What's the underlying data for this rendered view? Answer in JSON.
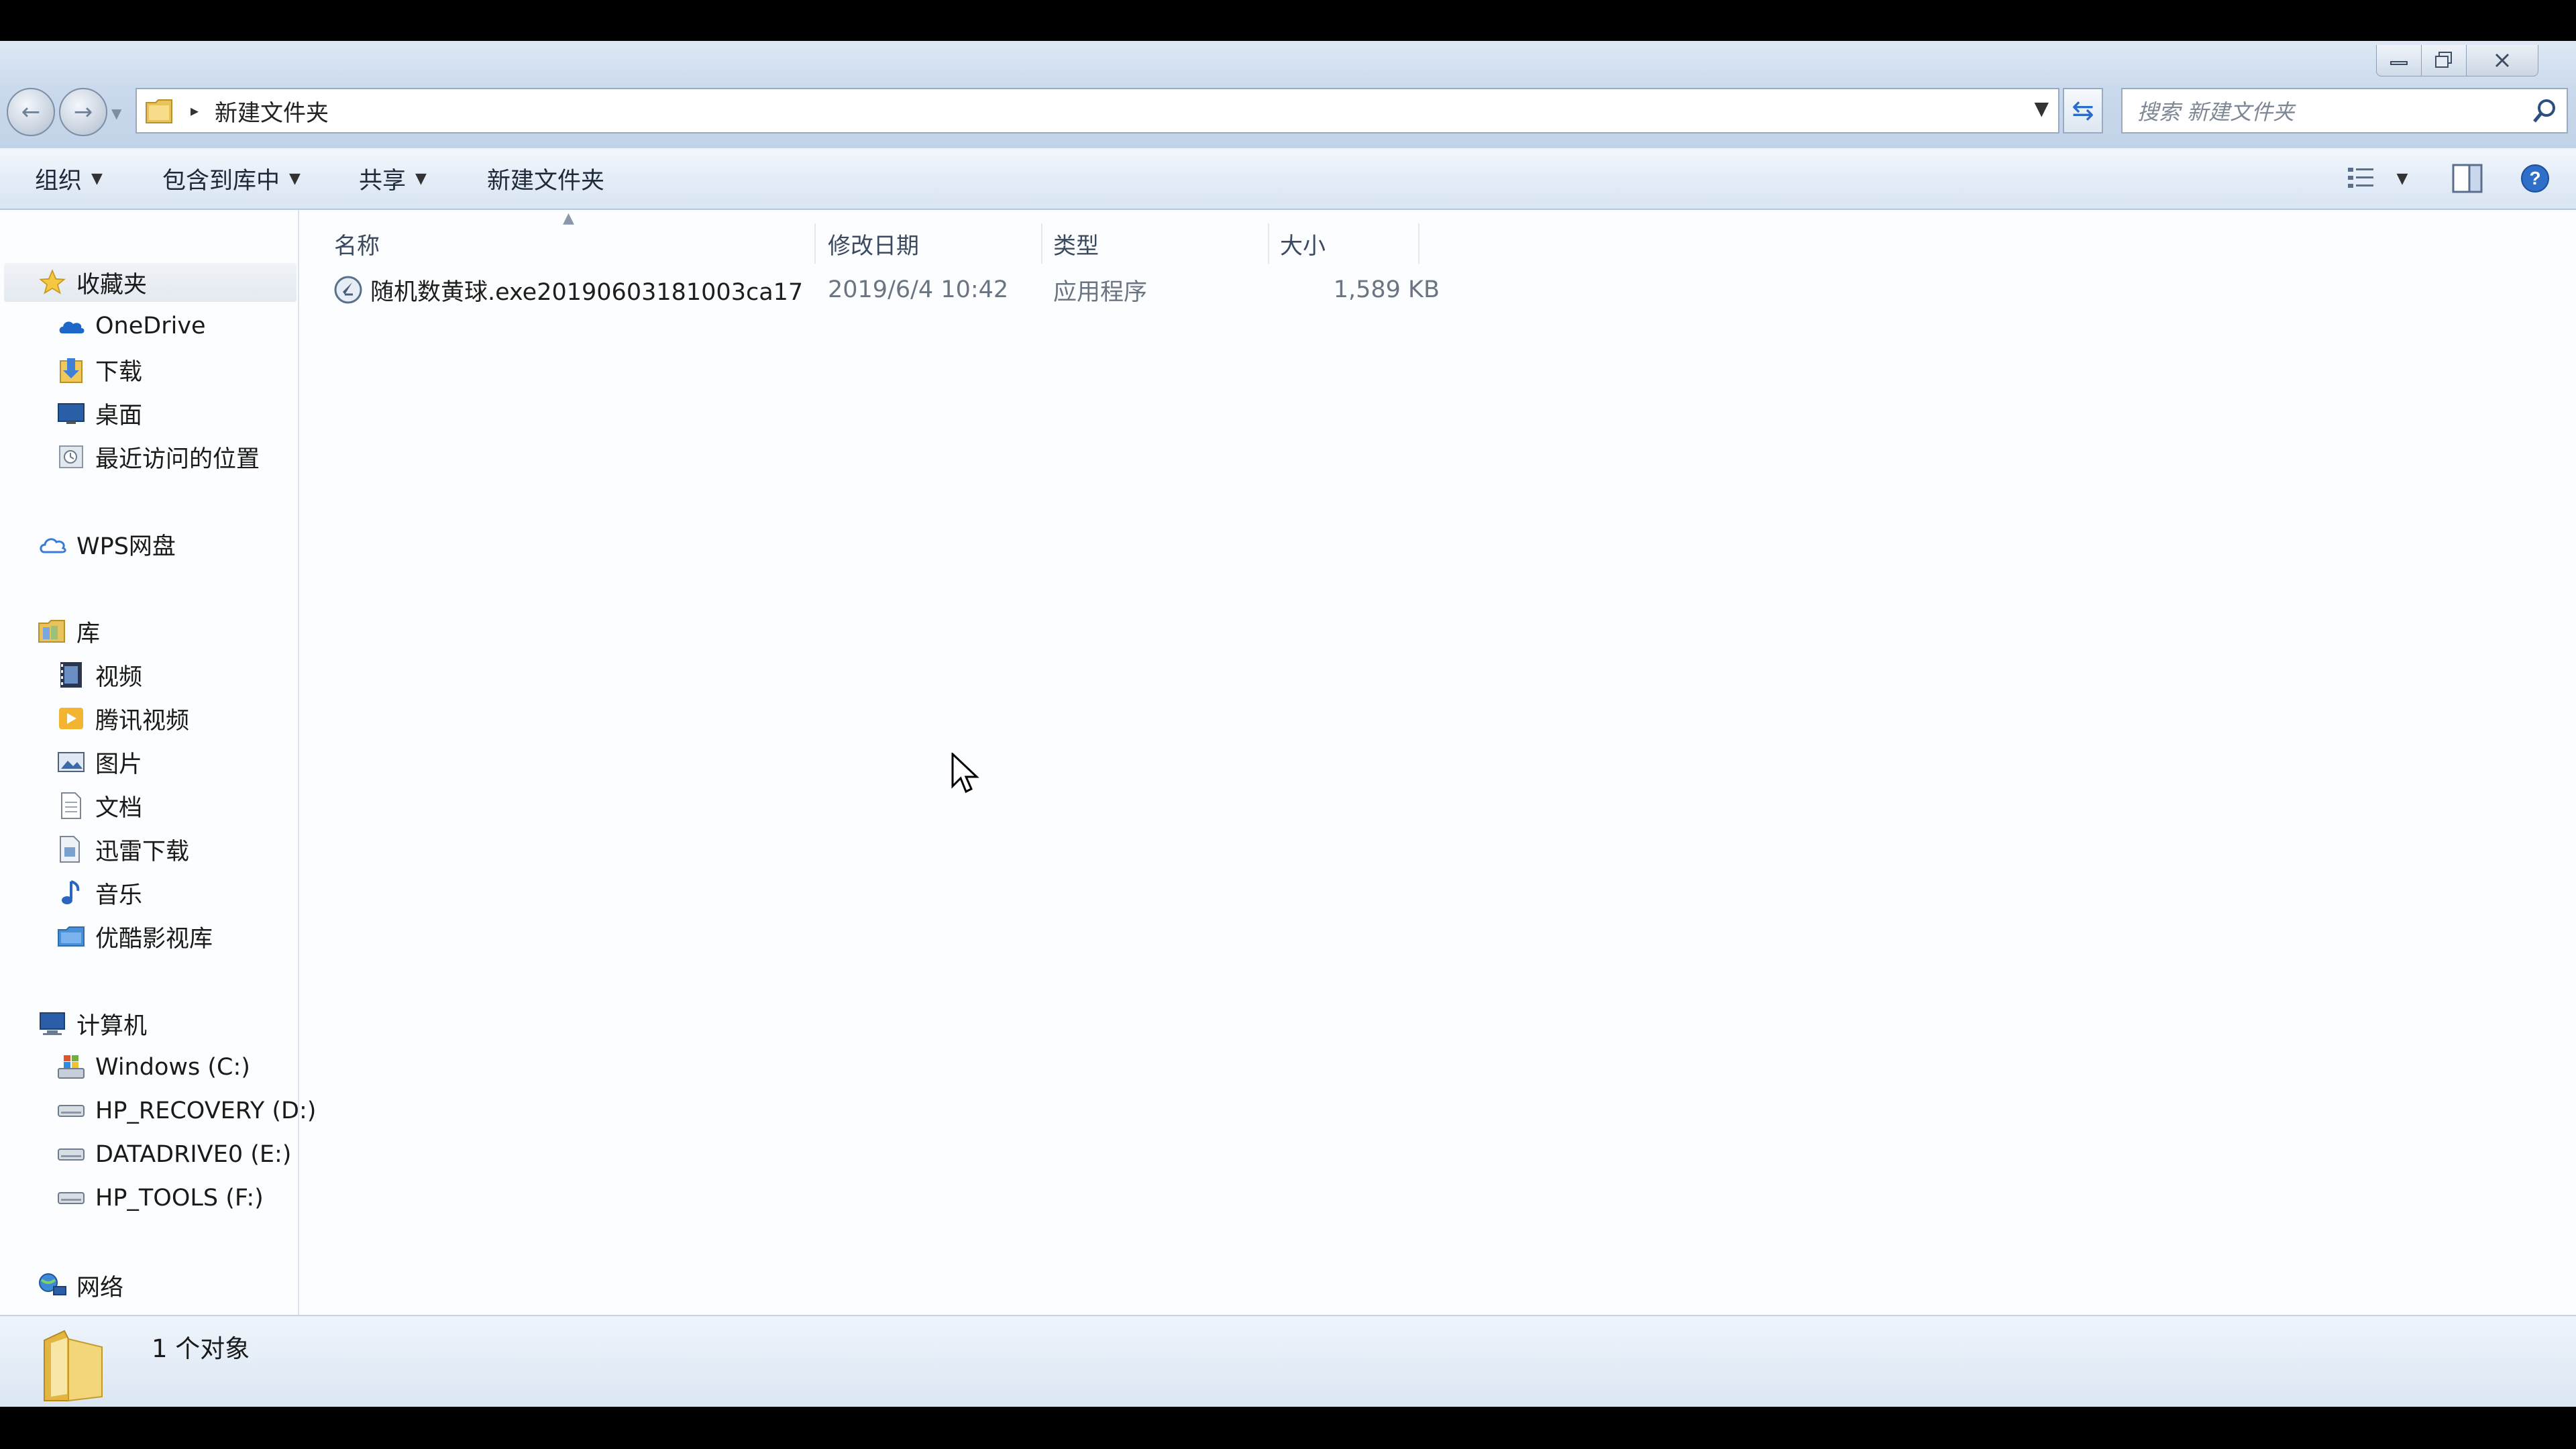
{
  "window": {
    "controls": {
      "minimize": "minimize",
      "maximize": "restore",
      "close": "close"
    }
  },
  "nav": {
    "back_icon": "back-arrow-icon",
    "forward_icon": "forward-arrow-icon"
  },
  "address": {
    "current_folder": "新建文件夹",
    "separator": "▸"
  },
  "search": {
    "placeholder": "搜索 新建文件夹"
  },
  "toolbar": {
    "organize": "组织",
    "include_in_library": "包含到库中",
    "share": "共享",
    "new_folder": "新建文件夹"
  },
  "sidebar": {
    "favorites": {
      "label": "收藏夹",
      "items": [
        {
          "label": "OneDrive",
          "icon": "onedrive-icon"
        },
        {
          "label": "下载",
          "icon": "downloads-icon"
        },
        {
          "label": "桌面",
          "icon": "desktop-icon"
        },
        {
          "label": "最近访问的位置",
          "icon": "recent-places-icon"
        }
      ]
    },
    "wps": {
      "label": "WPS网盘"
    },
    "libraries": {
      "label": "库",
      "items": [
        {
          "label": "视频"
        },
        {
          "label": "腾讯视频"
        },
        {
          "label": "图片"
        },
        {
          "label": "文档"
        },
        {
          "label": "迅雷下载"
        },
        {
          "label": "音乐"
        },
        {
          "label": "优酷影视库"
        }
      ]
    },
    "computer": {
      "label": "计算机",
      "items": [
        {
          "label": "Windows (C:)"
        },
        {
          "label": "HP_RECOVERY (D:)"
        },
        {
          "label": "DATADRIVE0 (E:)"
        },
        {
          "label": "HP_TOOLS (F:)"
        }
      ]
    },
    "network": {
      "label": "网络"
    }
  },
  "filelist": {
    "columns": [
      "名称",
      "修改日期",
      "类型",
      "大小"
    ],
    "rows": [
      {
        "name": "随机数黄球.exe20190603181003ca17",
        "modified": "2019/6/4 10:42",
        "type": "应用程序",
        "size": "1,589 KB"
      }
    ]
  },
  "status": {
    "count_text": "1 个对象"
  },
  "colors": {
    "window_bg": "#fbfdff",
    "toolbar_grad_top": "#f3f7fc",
    "titlebar": "#cad9ec",
    "text_muted": "#6b7582"
  }
}
